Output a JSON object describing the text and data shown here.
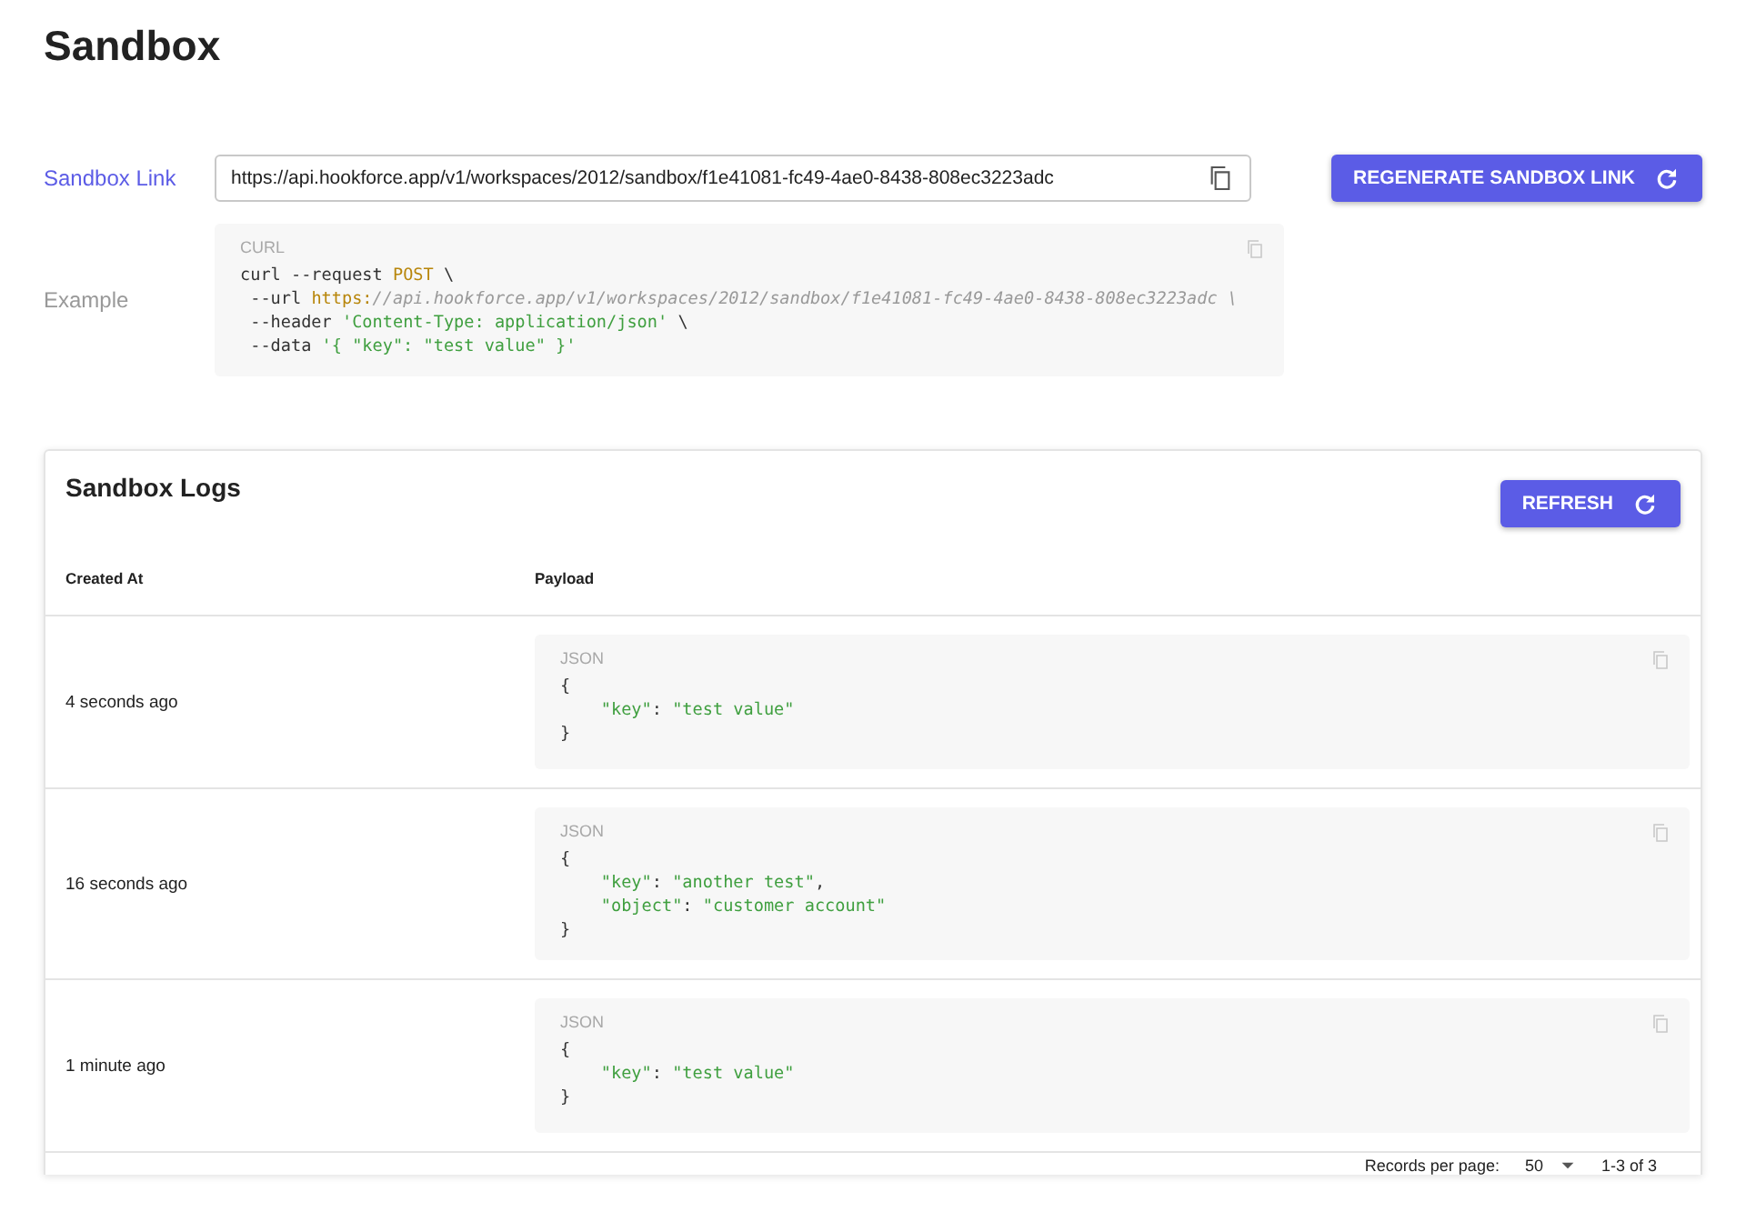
{
  "page": {
    "title": "Sandbox"
  },
  "sandbox_link": {
    "label": "Sandbox Link",
    "value": "https://api.hookforce.app/v1/workspaces/2012/sandbox/f1e41081-fc49-4ae0-8438-808ec3223adc",
    "button": "REGENERATE SANDBOX LINK"
  },
  "example": {
    "label": "Example",
    "language": "CURL",
    "lines": [
      [
        {
          "kind": "plain",
          "text": "curl --request "
        },
        {
          "kind": "keyword",
          "text": "POST"
        },
        {
          "kind": "plain",
          "text": " \\"
        }
      ],
      [
        {
          "kind": "plain",
          "text": " --url "
        },
        {
          "kind": "keyword",
          "text": "https:"
        },
        {
          "kind": "comment",
          "text": "//api.hookforce.app/v1/workspaces/2012/sandbox/f1e41081-fc49-4ae0-8438-808ec3223adc \\"
        }
      ],
      [
        {
          "kind": "plain",
          "text": " --header "
        },
        {
          "kind": "string",
          "text": "'Content-Type: application/json'"
        },
        {
          "kind": "plain",
          "text": " \\"
        }
      ],
      [
        {
          "kind": "plain",
          "text": " --data "
        },
        {
          "kind": "string",
          "text": "'{ \"key\": \"test value\" }'"
        }
      ]
    ]
  },
  "logs": {
    "title": "Sandbox Logs",
    "refresh": "REFRESH",
    "columns": [
      "Created At",
      "Payload"
    ],
    "rows": [
      {
        "created_at": "4 seconds ago",
        "language": "JSON",
        "lines": [
          [
            {
              "kind": "plain",
              "text": "{"
            }
          ],
          [
            {
              "kind": "string",
              "text": "    \"key\""
            },
            {
              "kind": "plain",
              "text": ": "
            },
            {
              "kind": "string",
              "text": "\"test value\""
            }
          ],
          [
            {
              "kind": "plain",
              "text": "}"
            }
          ]
        ]
      },
      {
        "created_at": "16 seconds ago",
        "language": "JSON",
        "lines": [
          [
            {
              "kind": "plain",
              "text": "{"
            }
          ],
          [
            {
              "kind": "string",
              "text": "    \"key\""
            },
            {
              "kind": "plain",
              "text": ": "
            },
            {
              "kind": "string",
              "text": "\"another test\""
            },
            {
              "kind": "plain",
              "text": ","
            }
          ],
          [
            {
              "kind": "string",
              "text": "    \"object\""
            },
            {
              "kind": "plain",
              "text": ": "
            },
            {
              "kind": "string",
              "text": "\"customer account\""
            }
          ],
          [
            {
              "kind": "plain",
              "text": "}"
            }
          ]
        ]
      },
      {
        "created_at": "1 minute ago",
        "language": "JSON",
        "lines": [
          [
            {
              "kind": "plain",
              "text": "{"
            }
          ],
          [
            {
              "kind": "string",
              "text": "    \"key\""
            },
            {
              "kind": "plain",
              "text": ": "
            },
            {
              "kind": "string",
              "text": "\"test value\""
            }
          ],
          [
            {
              "kind": "plain",
              "text": "}"
            }
          ]
        ]
      }
    ],
    "footer": {
      "records_label": "Records per page:",
      "records_value": "50",
      "range": "1-3 of 3"
    }
  }
}
